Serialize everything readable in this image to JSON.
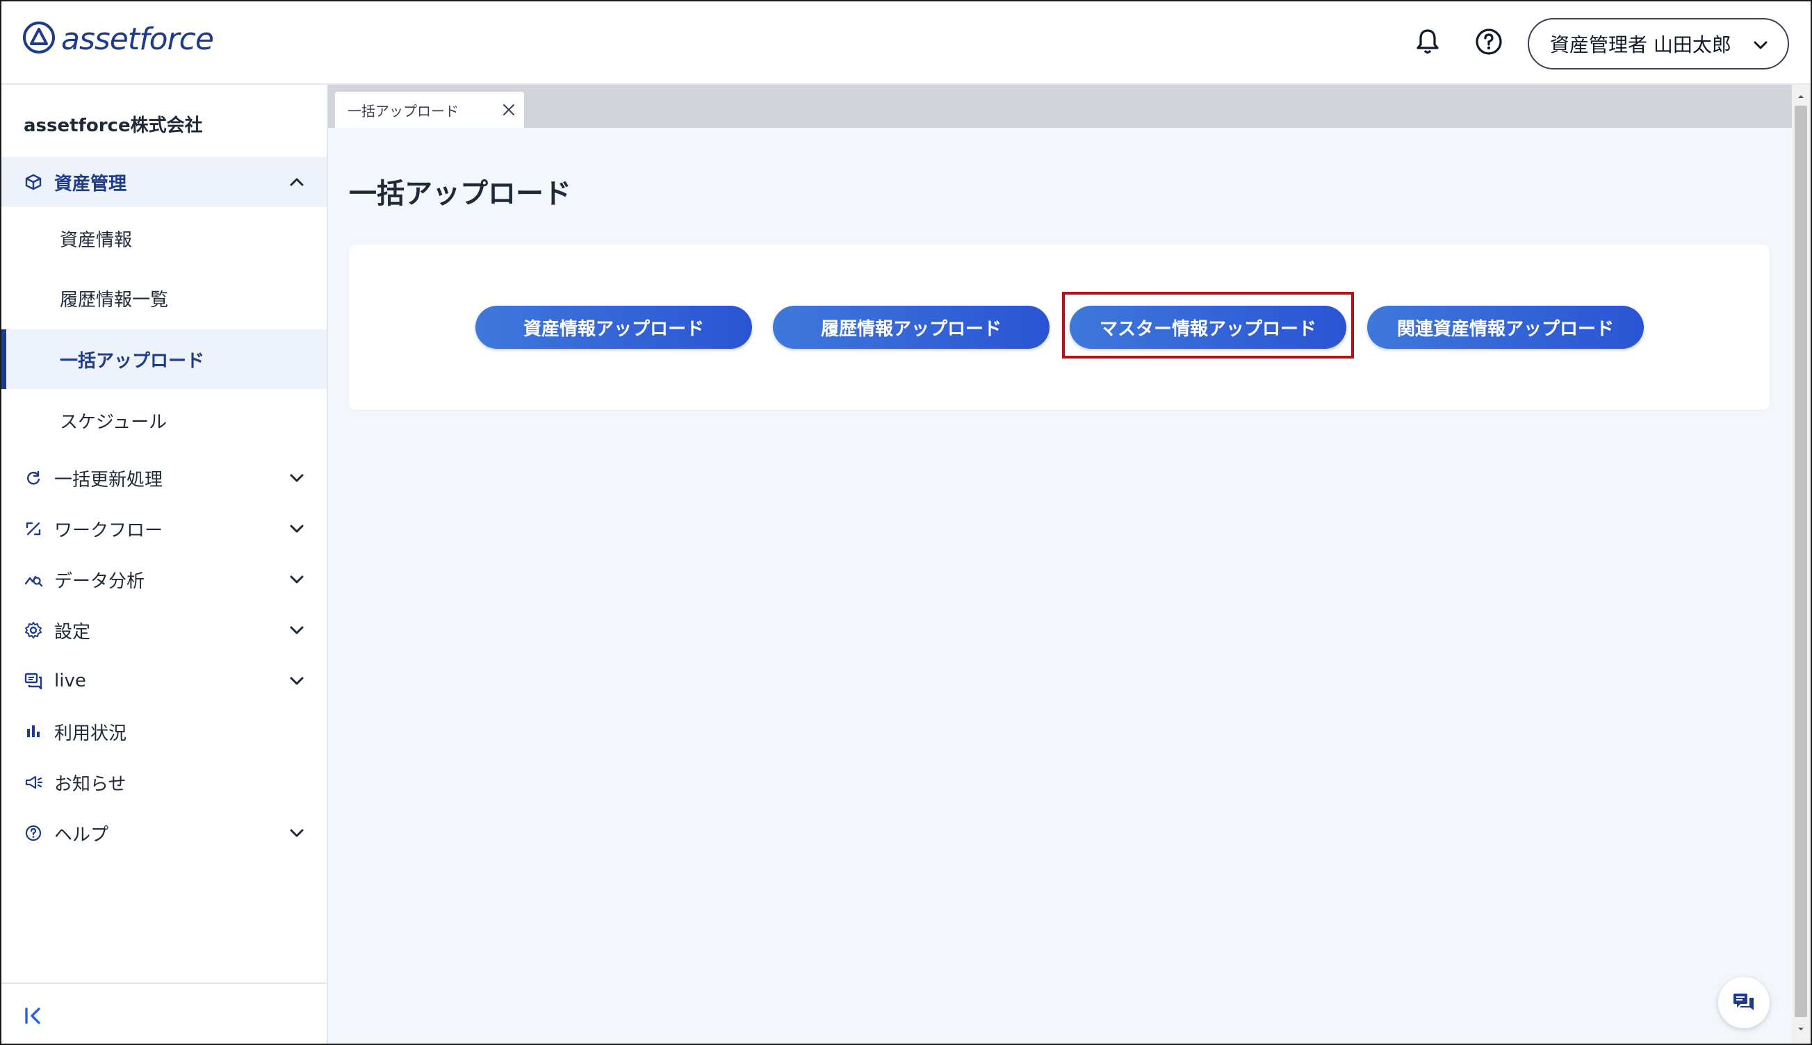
{
  "header": {
    "logo_text": "assetforce",
    "user_label": "資産管理者 山田太郎",
    "icons": [
      "bell-icon",
      "help-circle-icon",
      "chevron-down-icon"
    ]
  },
  "sidebar": {
    "company": "assetforce株式会社",
    "items": [
      {
        "label": "資産管理",
        "icon": "box-icon",
        "expanded": true,
        "children": [
          {
            "label": "資産情報"
          },
          {
            "label": "履歴情報一覧"
          },
          {
            "label": "一括アップロード",
            "active": true
          },
          {
            "label": "スケジュール"
          }
        ]
      },
      {
        "label": "一括更新処理",
        "icon": "refresh-icon",
        "expandable": true
      },
      {
        "label": "ワークフロー",
        "icon": "workflow-icon",
        "expandable": true
      },
      {
        "label": "データ分析",
        "icon": "analytics-icon",
        "expandable": true
      },
      {
        "label": "設定",
        "icon": "gear-icon",
        "expandable": true
      },
      {
        "label": "live",
        "icon": "live-icon",
        "expandable": true
      },
      {
        "label": "利用状況",
        "icon": "bar-chart-icon"
      },
      {
        "label": "お知らせ",
        "icon": "megaphone-icon"
      },
      {
        "label": "ヘルプ",
        "icon": "help-icon",
        "expandable": true
      }
    ]
  },
  "tabs": [
    {
      "label": "一括アップロード",
      "closable": true
    }
  ],
  "main": {
    "title": "一括アップロード",
    "buttons": [
      {
        "label": "資産情報アップロード"
      },
      {
        "label": "履歴情報アップロード"
      },
      {
        "label": "マスター情報アップロード",
        "highlighted": true
      },
      {
        "label": "関連資産情報アップロード"
      }
    ]
  },
  "colors": {
    "brand": "#1e3a8a",
    "button_gradient_start": "#3f78db",
    "button_gradient_end": "#2a54d4",
    "highlight": "#b3131b",
    "main_bg": "#f3f6fb"
  }
}
